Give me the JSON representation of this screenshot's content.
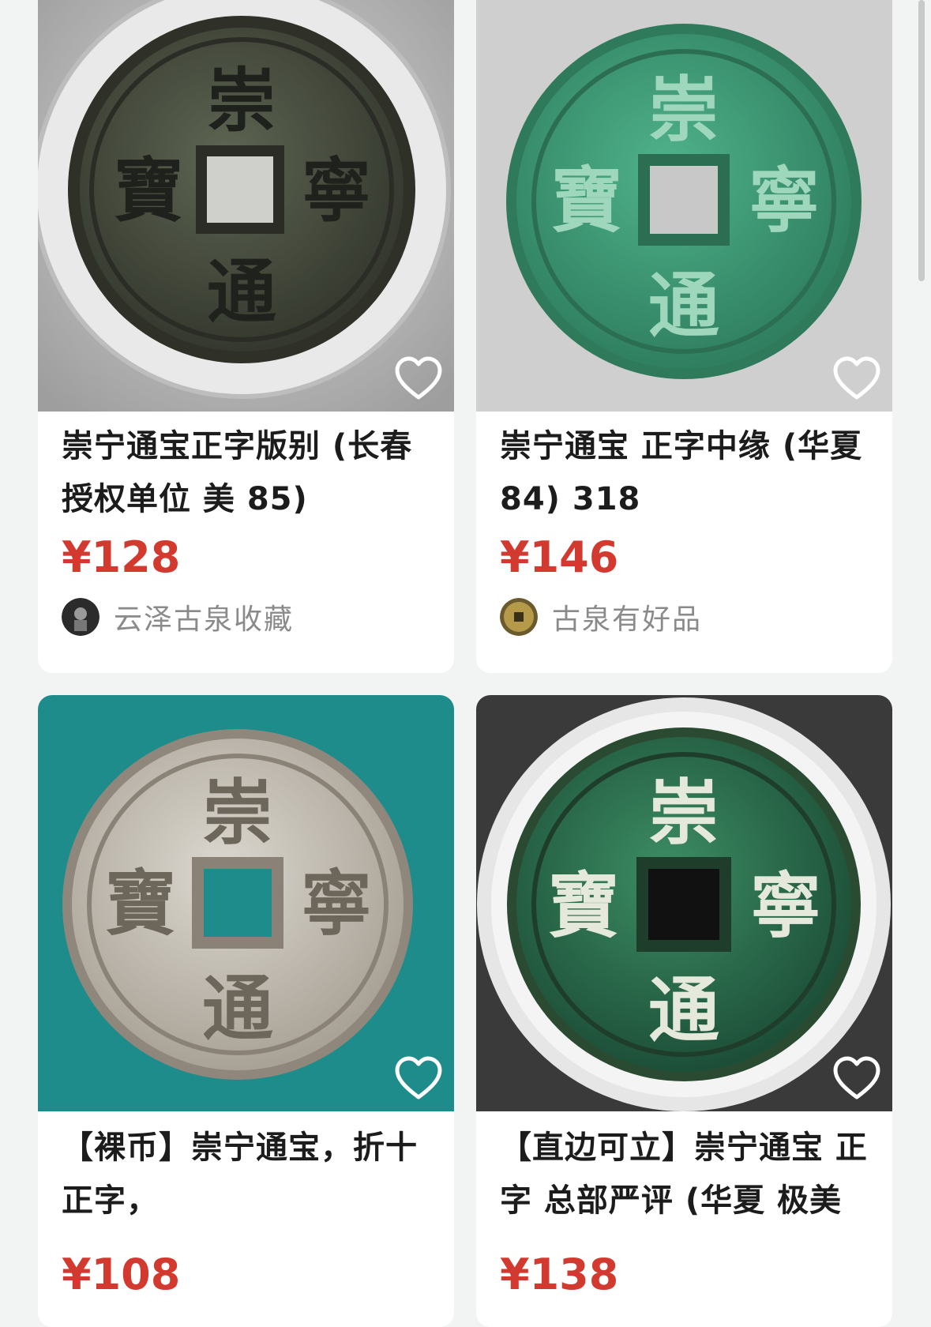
{
  "colors": {
    "page_bg": "#f2f3f3",
    "price": "#d33a2f",
    "title": "#1c1c1c",
    "shop_name": "#8a8a8a"
  },
  "products": [
    {
      "title": "崇宁通宝正字版别 (长春授权单位 美 85)",
      "price": "¥128",
      "shop": "云泽古泉收藏",
      "image_icon": "coin-photo-dark-bronze-in-holder",
      "favorite_icon": "heart-outline-icon"
    },
    {
      "title": "崇宁通宝 正字中缘 (华夏 84) 318",
      "price": "¥146",
      "shop": "古泉有好品",
      "image_icon": "coin-photo-green-patina",
      "favorite_icon": "heart-outline-icon"
    },
    {
      "title": "【裸币】崇宁通宝，折十正字，",
      "price": "¥108",
      "shop": "",
      "image_icon": "coin-photo-silver-on-teal",
      "favorite_icon": "heart-outline-icon"
    },
    {
      "title": "【直边可立】崇宁通宝 正字 总部严评 (华夏 极美",
      "price": "¥138",
      "shop": "",
      "image_icon": "coin-photo-green-in-slab",
      "favorite_icon": "heart-outline-icon"
    }
  ],
  "coin_inscription": {
    "top": "崇",
    "right": "寧",
    "bottom": "通",
    "left": "寶"
  }
}
